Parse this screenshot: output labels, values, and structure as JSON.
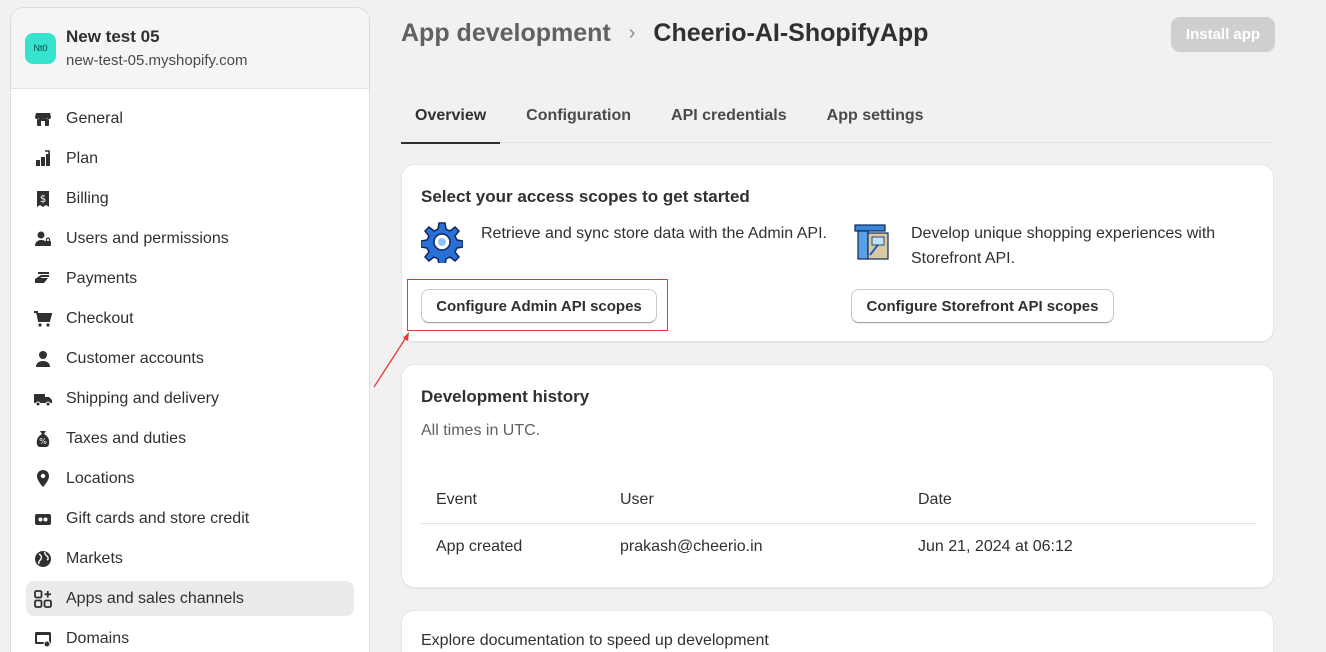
{
  "store": {
    "avatar_text": "Nt0",
    "name": "New test 05",
    "domain": "new-test-05.myshopify.com",
    "avatar_color": "#36e3cf"
  },
  "nav": [
    {
      "label": "General",
      "icon": "store-icon"
    },
    {
      "label": "Plan",
      "icon": "plan-icon"
    },
    {
      "label": "Billing",
      "icon": "billing-icon"
    },
    {
      "label": "Users and permissions",
      "icon": "users-icon"
    },
    {
      "label": "Payments",
      "icon": "payments-icon"
    },
    {
      "label": "Checkout",
      "icon": "cart-icon"
    },
    {
      "label": "Customer accounts",
      "icon": "person-icon"
    },
    {
      "label": "Shipping and delivery",
      "icon": "truck-icon"
    },
    {
      "label": "Taxes and duties",
      "icon": "tax-icon"
    },
    {
      "label": "Locations",
      "icon": "location-icon"
    },
    {
      "label": "Gift cards and store credit",
      "icon": "gift-card-icon"
    },
    {
      "label": "Markets",
      "icon": "globe-icon"
    },
    {
      "label": "Apps and sales channels",
      "icon": "apps-icon",
      "active": true
    },
    {
      "label": "Domains",
      "icon": "domains-icon"
    }
  ],
  "header": {
    "parent": "App development",
    "separator": "›",
    "current": "Cheerio-AI-ShopifyApp",
    "install_label": "Install app"
  },
  "tabs": [
    {
      "label": "Overview",
      "active": true
    },
    {
      "label": "Configuration"
    },
    {
      "label": "API credentials"
    },
    {
      "label": "App settings"
    }
  ],
  "scopes": {
    "title": "Select your access scopes to get started",
    "admin": {
      "icon": "gear-icon",
      "description": "Retrieve and sync store data with the Admin API.",
      "button": "Configure Admin API scopes"
    },
    "storefront": {
      "icon": "storefront-icon",
      "description": "Develop unique shopping experiences with Storefront API.",
      "button": "Configure Storefront API scopes"
    }
  },
  "history": {
    "title": "Development history",
    "subtitle": "All times in UTC.",
    "columns": [
      "Event",
      "User",
      "Date"
    ],
    "rows": [
      {
        "event": "App created",
        "user": "prakash@cheerio.in",
        "date": "Jun 21, 2024 at 06:12"
      }
    ]
  },
  "docs": {
    "title": "Explore documentation to speed up development"
  },
  "colors": {
    "highlight": "#e23a3a",
    "disabled_button": "#cfcfcf"
  }
}
